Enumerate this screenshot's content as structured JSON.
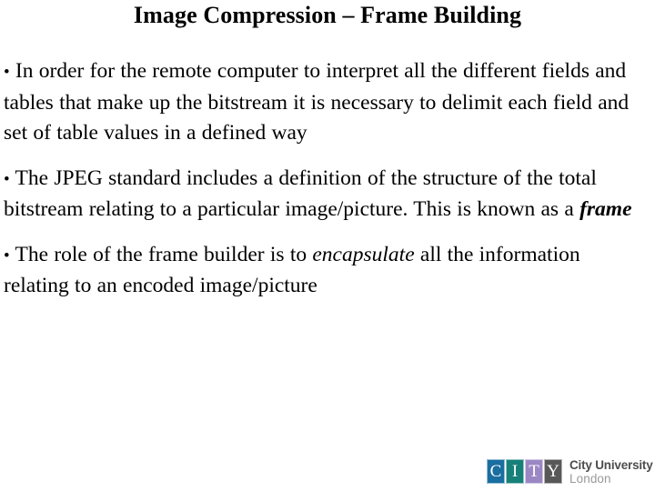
{
  "slide": {
    "title": "Image Compression – Frame Building",
    "background_color": "#ffffff",
    "text_color": "#000000",
    "bullets": [
      {
        "mark": "•",
        "segments": [
          {
            "text": " In order for the remote computer to interpret all the different fields and tables that make up the bitstream it is necessary to delimit each field and set of table values in a defined way",
            "style": "normal"
          }
        ]
      },
      {
        "mark": "•",
        "segments": [
          {
            "text": " The JPEG standard includes a definition of the structure of the total bitstream relating to a particular image/picture. This is known as a ",
            "style": "normal"
          },
          {
            "text": "frame",
            "style": "bold-italic"
          }
        ]
      },
      {
        "mark": "•",
        "segments": [
          {
            "text": " The role of the frame builder is to ",
            "style": "normal"
          },
          {
            "text": "encapsulate",
            "style": "italic"
          },
          {
            "text": " all the information relating to an encoded image/picture",
            "style": "normal"
          }
        ]
      }
    ]
  },
  "logo": {
    "name": "city-university-london-logo",
    "tiles": [
      {
        "letter": "C",
        "color": "#1a6ea0"
      },
      {
        "letter": "I",
        "color": "#168079"
      },
      {
        "letter": "T",
        "color": "#9b87c4"
      },
      {
        "letter": "Y",
        "color": "#585858"
      }
    ],
    "line1": "City University",
    "line2": "London",
    "line1_color": "#4d4d4d",
    "line2_color": "#9a9a9a"
  }
}
